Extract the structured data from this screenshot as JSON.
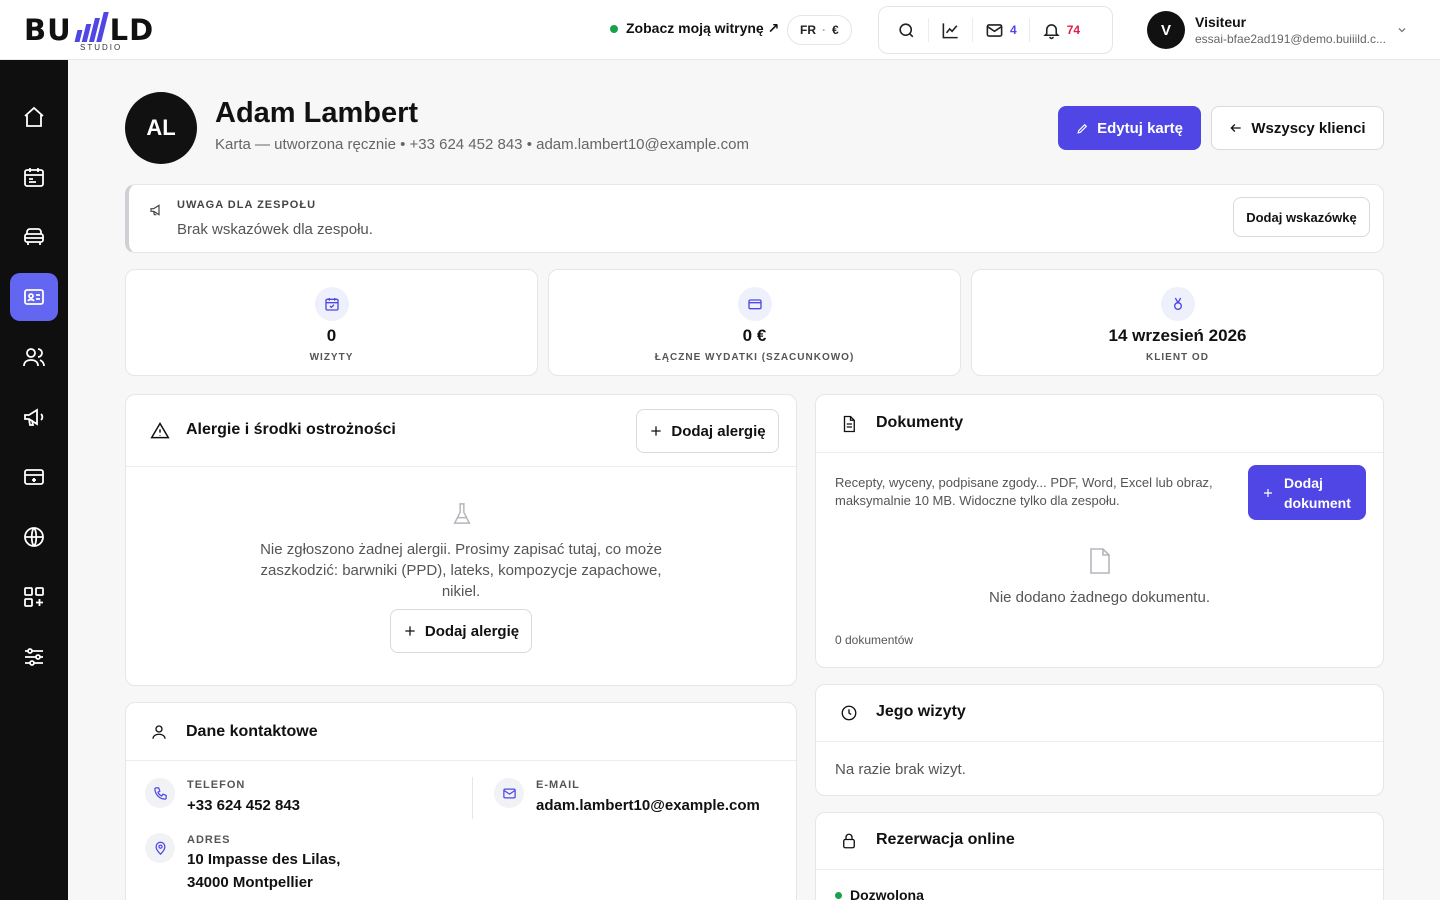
{
  "brand": {
    "logo_left": "BU",
    "logo_right": "LD",
    "logo_sub": "STUDIO"
  },
  "header": {
    "site_link": "Zobacz moją witrynę ↗",
    "lang": "FR",
    "currency": "€",
    "messages_count": "4",
    "notifications_count": "74",
    "user": {
      "initial": "V",
      "name": "Visiteur",
      "email": "essai-bfae2ad191@demo.buiiild.c..."
    }
  },
  "profile": {
    "initials": "AL",
    "name": "Adam Lambert",
    "meta": "Karta — utworzona ręcznie • +33 624 452 843 • adam.lambert10@example.com",
    "edit_label": "Edytuj kartę",
    "back_label": "Wszyscy klienci"
  },
  "notice": {
    "title": "UWAGA DLA ZESPOŁU",
    "text": "Brak wskazówek dla zespołu.",
    "button": "Dodaj wskazówkę"
  },
  "stats": [
    {
      "value": "0",
      "label": "WIZYTY"
    },
    {
      "value": "0 €",
      "label": "ŁĄCZNE WYDATKI (SZACUNKOWO)"
    },
    {
      "value": "14 wrzesień 2026",
      "label": "KLIENT OD"
    }
  ],
  "allergies": {
    "title": "Alergie i środki ostrożności",
    "add_label": "Dodaj alergię",
    "empty_text": "Nie zgłoszono żadnej alergii. Prosimy zapisać tutaj, co może zaszkodzić: barwniki (PPD), lateks, kompozycje zapachowe, nikiel.",
    "empty_button": "Dodaj alergię"
  },
  "contact": {
    "title": "Dane kontaktowe",
    "phone_label": "TELEFON",
    "phone": "+33 624 452 843",
    "email_label": "E-MAIL",
    "email": "adam.lambert10@example.com",
    "address_label": "ADRES",
    "address_line1": "10 Impasse des Lilas,",
    "address_line2": "34000 Montpellier"
  },
  "documents": {
    "title": "Dokumenty",
    "description": "Recepty, wyceny, podpisane zgody... PDF, Word, Excel lub obraz, maksymalnie 10 MB. Widoczne tylko dla zespołu.",
    "add_label_1": "Dodaj",
    "add_label_2": "dokument",
    "empty_text": "Nie dodano żadnego dokumentu.",
    "count": "0 dokumentów"
  },
  "visits": {
    "title": "Jego wizyty",
    "empty_text": "Na razie brak wizyt."
  },
  "booking": {
    "title": "Rezerwacja online",
    "status": "Dozwolona"
  },
  "colors": {
    "accent": "#4f46e5",
    "sidebar_active": "#6366f1",
    "sidebar_bg": "#0f0f10",
    "online": "#16a34a"
  }
}
